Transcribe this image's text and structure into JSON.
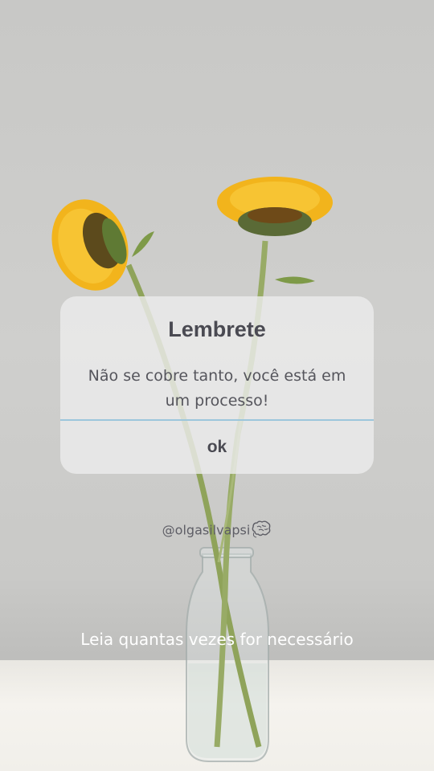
{
  "dialog": {
    "title": "Lembrete",
    "message": "Não se cobre tanto, você está em um processo!",
    "ok_label": "ok"
  },
  "handle": "@olgasilvapsi",
  "caption": "Leia quantas vezes for necessário",
  "icons": {
    "brain": "brain-icon"
  },
  "colors": {
    "petals": "#f2b41c",
    "stem": "#8fa35a",
    "divider": "#9cc6dc",
    "text": "#4a4a52"
  }
}
